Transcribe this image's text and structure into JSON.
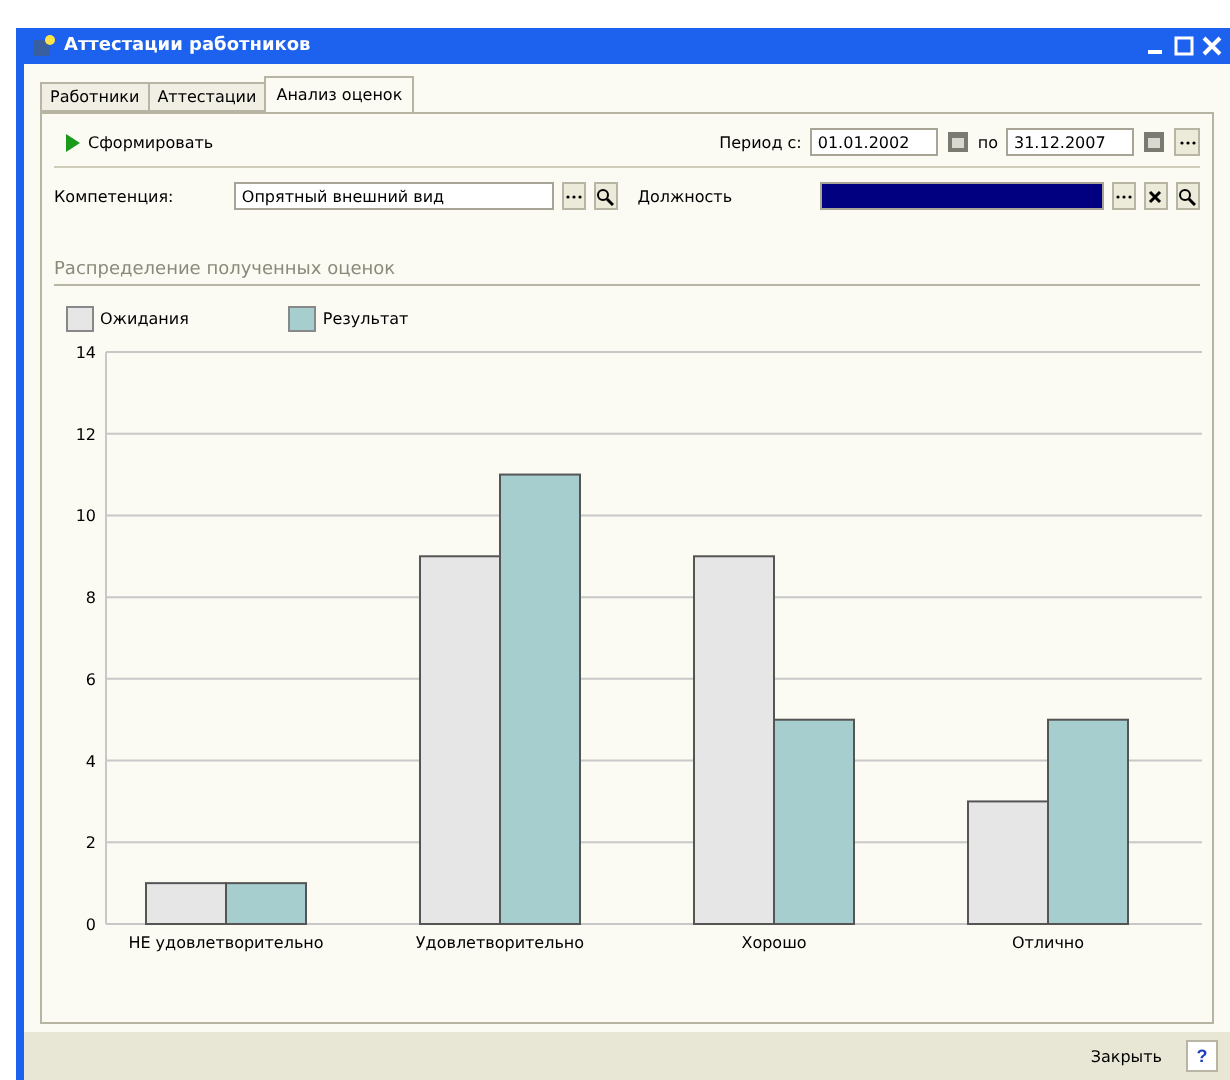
{
  "window": {
    "title": "Аттестации работников"
  },
  "tabs": [
    {
      "label": "Работники",
      "selected": false
    },
    {
      "label": "Аттестации",
      "selected": false
    },
    {
      "label": "Анализ оценок",
      "selected": true
    }
  ],
  "toolbar": {
    "run_button": "Сформировать",
    "period_label": "Период с:",
    "date_from": "01.01.2002",
    "to_label": "по",
    "date_to": "31.12.2007"
  },
  "filters": {
    "competence_label": "Компетенция:",
    "competence_value": "Опрятный внешний вид",
    "position_label": "Должность"
  },
  "section_title": "Распределение полученных оценок",
  "chart_data": {
    "type": "bar",
    "categories": [
      "НЕ удовлетворительно",
      "Удовлетворительно",
      "Хорошо",
      "Отлично"
    ],
    "series": [
      {
        "name": "Ожидания",
        "color": "#e6e6e6",
        "values": [
          1,
          9,
          9,
          3
        ]
      },
      {
        "name": "Результат",
        "color": "#a6cece",
        "values": [
          1,
          11,
          5,
          5
        ]
      }
    ],
    "ylim": [
      0,
      14
    ],
    "grid": true,
    "yticks": [
      0,
      2,
      4,
      6,
      8,
      10,
      12,
      14
    ]
  },
  "footer": {
    "close_button": "Закрыть",
    "help_button": "?"
  }
}
